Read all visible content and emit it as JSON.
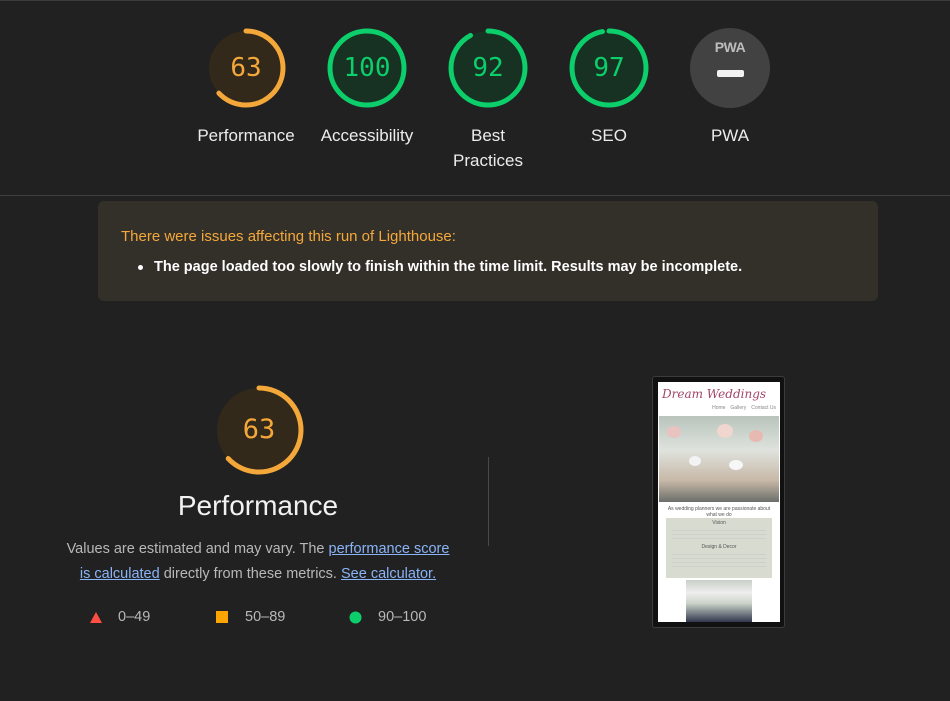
{
  "categories": [
    {
      "label": "Performance",
      "score": "63",
      "color": "#f5a83a",
      "fill": 0.63
    },
    {
      "label": "Accessibility",
      "score": "100",
      "color": "#0cce6b",
      "fill": 1.0
    },
    {
      "label_line1": "Best",
      "label_line2": "Practices",
      "score": "92",
      "color": "#0cce6b",
      "fill": 0.92
    },
    {
      "label": "SEO",
      "score": "97",
      "color": "#0cce6b",
      "fill": 0.97
    },
    {
      "label": "PWA",
      "badge": "PWA",
      "color": "#9e9e9e"
    }
  ],
  "warning": {
    "title": "There were issues affecting this run of Lighthouse:",
    "items": [
      "The page loaded too slowly to finish within the time limit. Results may be incomplete."
    ]
  },
  "performance": {
    "score": "63",
    "fill": 0.63,
    "title": "Performance",
    "desc_prefix": "Values are estimated and may vary. The ",
    "link_score": "performance score",
    "link_score_2": "is calculated",
    "desc_mid": " directly from these metrics. ",
    "link_calc": "See calculator."
  },
  "legend": [
    {
      "range": "0–49",
      "shape": "triangle",
      "color": "#ff4e42"
    },
    {
      "range": "50–89",
      "shape": "square",
      "color": "#ffa400"
    },
    {
      "range": "90–100",
      "shape": "circle",
      "color": "#0cce6b"
    }
  ],
  "thumbnail": {
    "brand": "Dream Weddings",
    "nav": [
      "Home",
      "Gallery",
      "Contact Us"
    ],
    "heading": "As wedding planners we are passionate about what we do",
    "sub1": "Vision",
    "sub2": "Design & Decor"
  }
}
